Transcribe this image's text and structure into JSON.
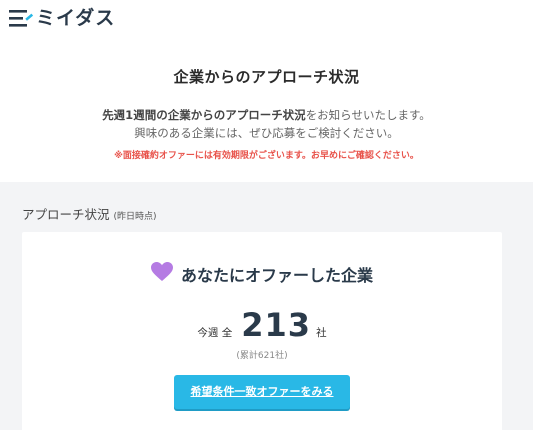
{
  "header": {
    "logo_text": "ミイダス",
    "logo_icon": "miidas-logo"
  },
  "hero": {
    "title": "企業からのアプローチ状況",
    "desc_line1_bold": "先週1週間の企業からのアプローチ状況",
    "desc_line1_rest": "をお知らせいたします。",
    "desc_line2": "興味のある企業には、ぜひ応募をご検討ください。",
    "note": "※面接確約オファーには有効期限がございます。お早めにご確認ください。"
  },
  "section": {
    "label": "アプローチ状況",
    "label_sub": "(昨日時点)"
  },
  "card": {
    "title": "あなたにオファーした企業",
    "icon": "heart-icon",
    "count_prefix": "今週 全",
    "count": "213",
    "count_unit": "社",
    "cumulative": "(累計621社)",
    "cta_label": "希望条件一致オファーをみる"
  },
  "colors": {
    "accent": "#29b8e6",
    "heart": "#b57be3",
    "note_red": "#e8524a",
    "gray_bg": "#f3f4f6"
  }
}
